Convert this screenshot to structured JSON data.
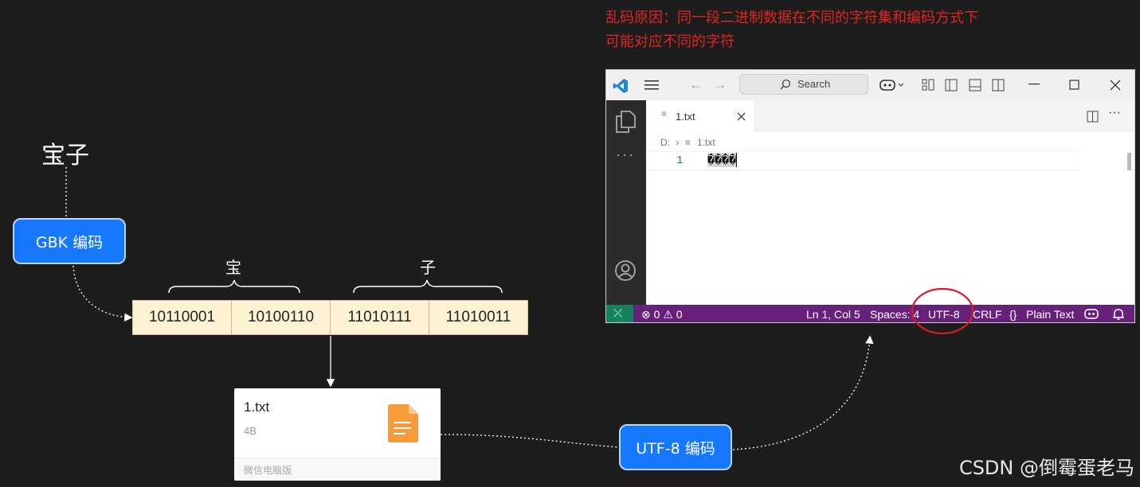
{
  "diagram": {
    "title": "宝子",
    "gbk_label": "GBK 编码",
    "utf8_label": "UTF-8 编码",
    "chars": [
      {
        "label": "宝"
      },
      {
        "label": "子"
      }
    ],
    "bytes": [
      "10110001",
      "10100110",
      "11010111",
      "11010011"
    ],
    "note_line1": "乱码原因：同一段二进制数据在不同的字符集和编码方式下",
    "note_line2": "可能对应不同的字符",
    "watermark": "CSDN @倒霉蛋老马",
    "highlight_color": "#e02424",
    "accent_color": "#1677ff"
  },
  "file_card": {
    "name": "1.txt",
    "size": "4B",
    "footer": "微信电脑版"
  },
  "vscode": {
    "search_label": "Search",
    "tab_label": "1.txt",
    "breadcrumb_drive": "D:",
    "breadcrumb_file": "1.txt",
    "line_number": "1",
    "line_content": "����",
    "status": {
      "errors": "0",
      "warnings": "0",
      "position": "Ln 1, Col 5",
      "spaces": "Spaces: 4",
      "encoding": "UTF-8",
      "eol": "CRLF",
      "language": "Plain Text"
    },
    "icons": [
      "vscode-logo-icon",
      "menu-icon",
      "back-arrow-icon",
      "forward-arrow-icon",
      "search-icon",
      "copilot-icon",
      "layout-icon",
      "sidebar-icon",
      "panel-icon",
      "split-icon",
      "minimize-icon",
      "maximize-icon",
      "close-icon",
      "explorer-icon",
      "more-icon",
      "account-icon",
      "settings-icon",
      "remote-icon",
      "bell-icon"
    ]
  }
}
